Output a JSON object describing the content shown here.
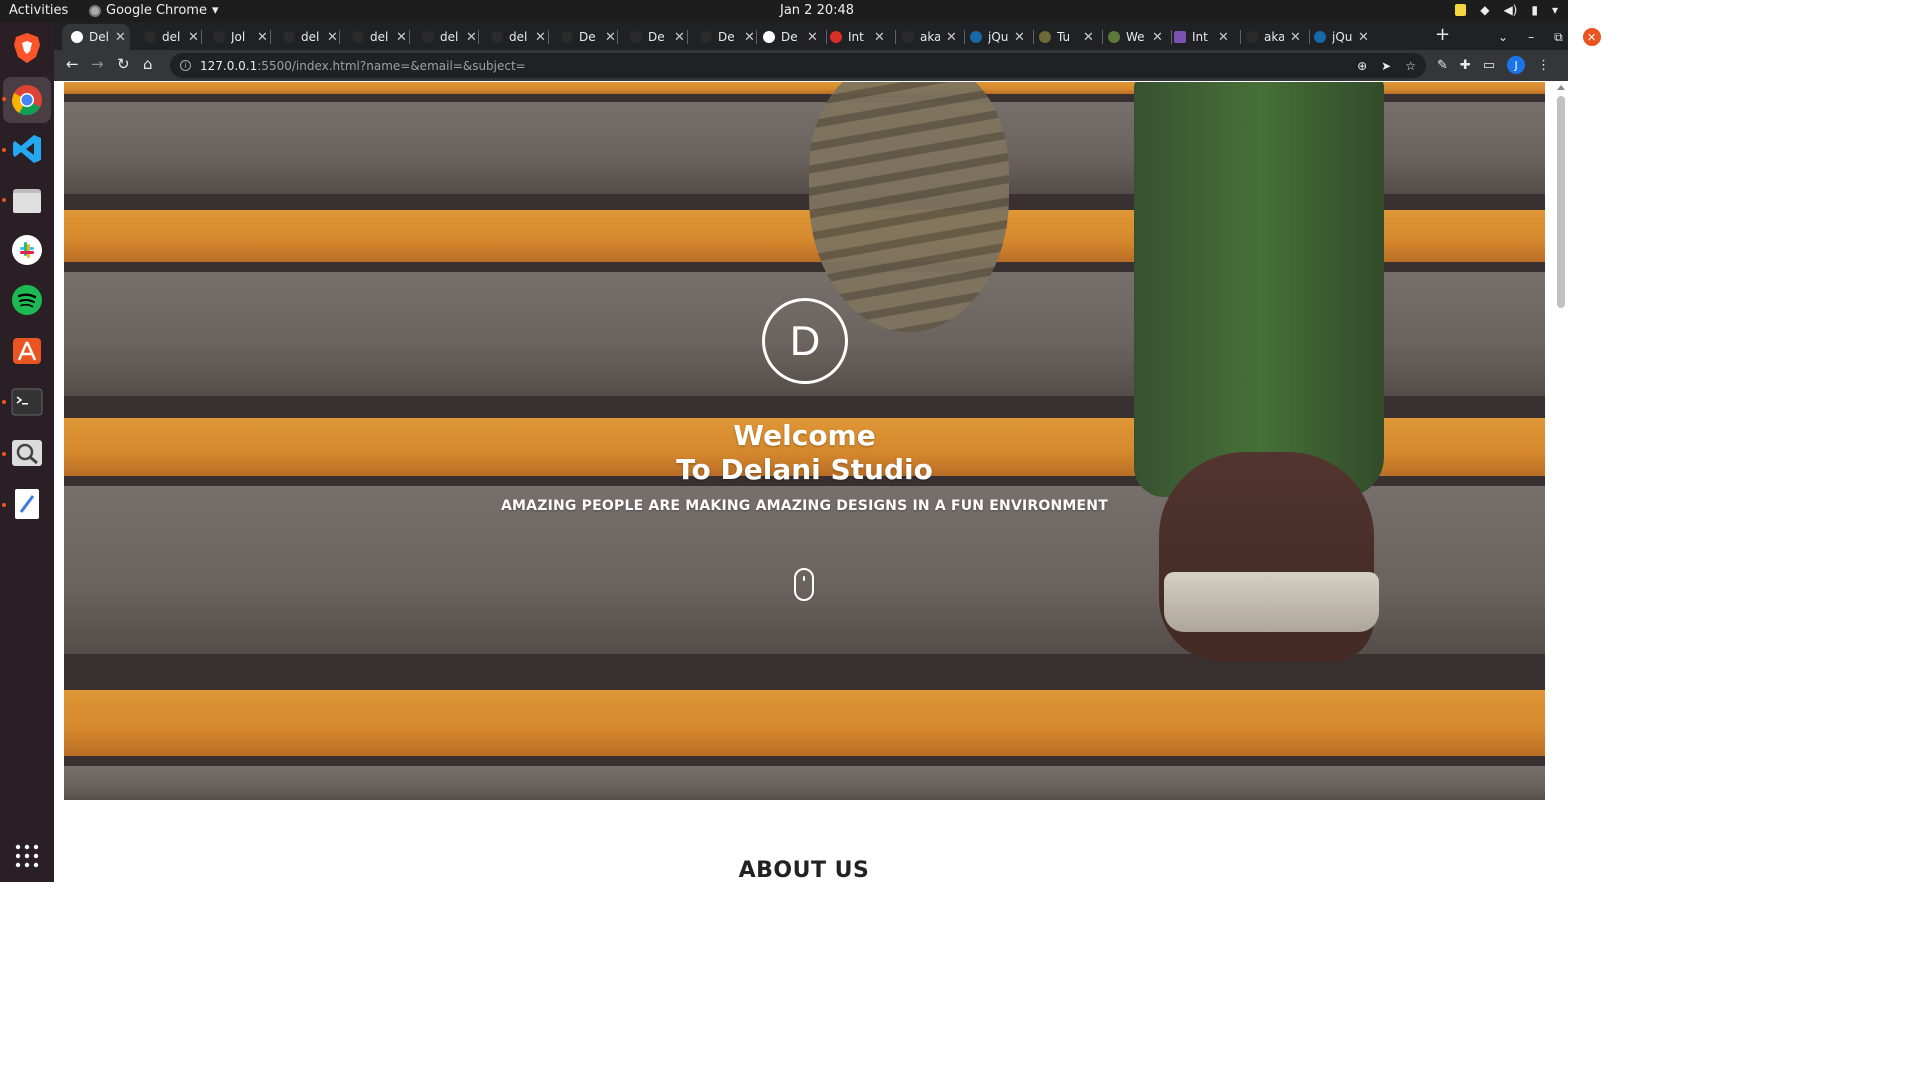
{
  "system_bar": {
    "activities": "Activities",
    "app_name": "Google Chrome",
    "clock": "Jan 2  20:48"
  },
  "dock": {
    "items": [
      {
        "name": "Brave",
        "icon": "brave-icon",
        "color": "#fb542b"
      },
      {
        "name": "Google Chrome",
        "icon": "chrome-icon",
        "color": "#4285f4"
      },
      {
        "name": "Visual Studio Code",
        "icon": "vscode-icon",
        "color": "#23a9f2"
      },
      {
        "name": "Files",
        "icon": "files-icon",
        "color": "#a9a9a9"
      },
      {
        "name": "Slack",
        "icon": "slack-icon",
        "color": "#ffffff"
      },
      {
        "name": "Spotify",
        "icon": "spotify-icon",
        "color": "#1db954"
      },
      {
        "name": "Ubuntu Software",
        "icon": "app-store-icon",
        "color": "#e95420"
      },
      {
        "name": "Terminal",
        "icon": "terminal-icon",
        "color": "#333333"
      },
      {
        "name": "Search",
        "icon": "magnifier-icon",
        "color": "#dddddd"
      },
      {
        "name": "Text Editor",
        "icon": "text-editor-icon",
        "color": "#3d7be0"
      }
    ],
    "show_apps_icon": "grid-icon"
  },
  "browser": {
    "tabs": [
      {
        "label": "Del",
        "active": true
      },
      {
        "label": "del"
      },
      {
        "label": "Jol"
      },
      {
        "label": "del"
      },
      {
        "label": "del"
      },
      {
        "label": "del"
      },
      {
        "label": "del"
      },
      {
        "label": "De"
      },
      {
        "label": "De"
      },
      {
        "label": "De"
      },
      {
        "label": "De"
      },
      {
        "label": "Int"
      },
      {
        "label": "aka"
      },
      {
        "label": "jQu"
      },
      {
        "label": "Tu"
      },
      {
        "label": "We"
      },
      {
        "label": "Int"
      },
      {
        "label": "aka"
      },
      {
        "label": "jQu"
      }
    ],
    "url_host": "127.0.0.1",
    "url_path": ":5500/index.html?name=&email=&subject=",
    "profile_initial": "J"
  },
  "page": {
    "logo_letter": "D",
    "welcome_line1": "Welcome",
    "welcome_line2": "To Delani Studio",
    "tagline": "AMAZING PEOPLE ARE MAKING AMAZING DESIGNS IN A FUN ENVIRONMENT",
    "about_title": "ABOUT US"
  }
}
